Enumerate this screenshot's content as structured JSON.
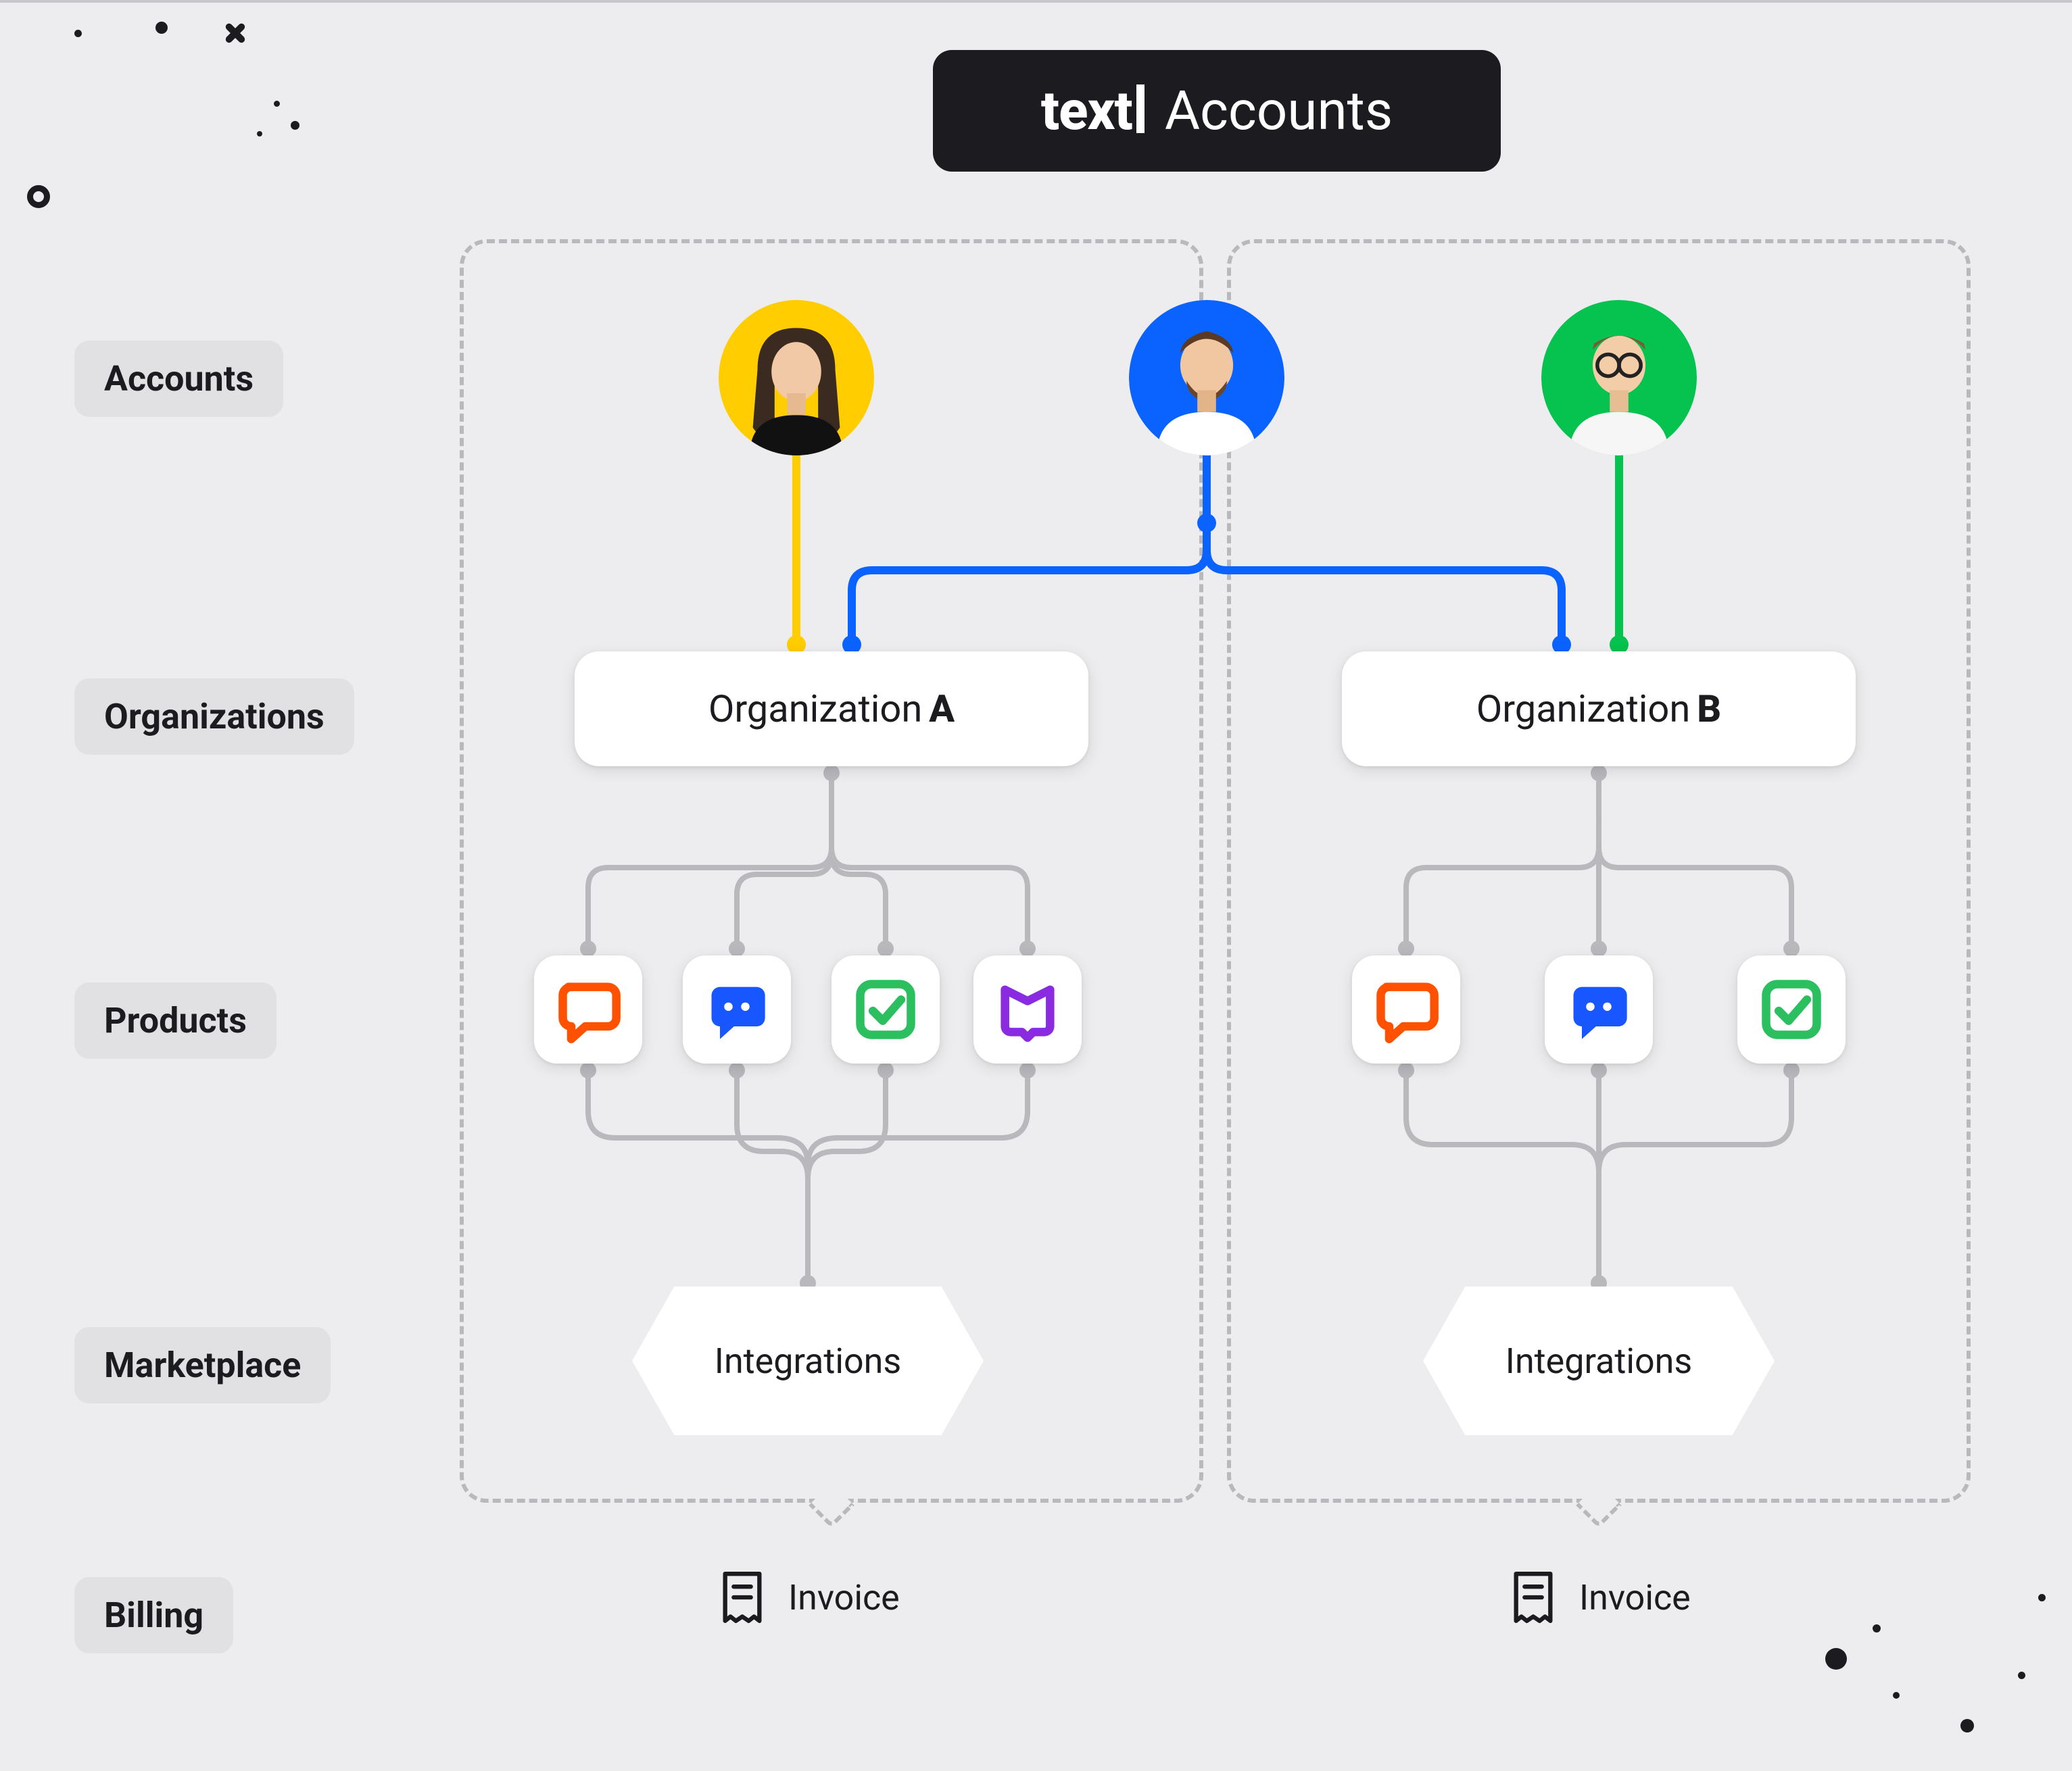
{
  "header": {
    "brand": "text",
    "title": "Accounts"
  },
  "rowLabels": {
    "accounts": "Accounts",
    "organizations": "Organizations",
    "products": "Products",
    "marketplace": "Marketplace",
    "billing": "Billing"
  },
  "avatars": [
    {
      "id": "avatar-1",
      "bg": "#ffcd00",
      "connector": "#ffcd00"
    },
    {
      "id": "avatar-2",
      "bg": "#0b63ff",
      "connector": "#0b63ff"
    },
    {
      "id": "avatar-3",
      "bg": "#06c24e",
      "connector": "#06c24e"
    }
  ],
  "organizations": {
    "a": {
      "label_prefix": "Organization",
      "label_bold": "A"
    },
    "b": {
      "label_prefix": "Organization",
      "label_bold": "B"
    }
  },
  "products": {
    "orgA": [
      {
        "id": "livechat",
        "icon": "speech-outline",
        "color": "#ff5100"
      },
      {
        "id": "chatbot",
        "icon": "speech-solid",
        "color": "#1856ff"
      },
      {
        "id": "helpdesk",
        "icon": "check-square",
        "color": "#2bbf5f"
      },
      {
        "id": "knowledge",
        "icon": "book",
        "color": "#8a2be2"
      }
    ],
    "orgB": [
      {
        "id": "livechat",
        "icon": "speech-outline",
        "color": "#ff5100"
      },
      {
        "id": "chatbot",
        "icon": "speech-solid",
        "color": "#1856ff"
      },
      {
        "id": "helpdesk",
        "icon": "check-square",
        "color": "#2bbf5f"
      }
    ]
  },
  "integrations": {
    "a": "Integrations",
    "b": "Integrations"
  },
  "billing": {
    "a": "Invoice",
    "b": "Invoice"
  },
  "colors": {
    "connectorGrey": "#b8b8bd",
    "yellow": "#ffcd00",
    "blue": "#0b63ff",
    "green": "#06c24e"
  }
}
